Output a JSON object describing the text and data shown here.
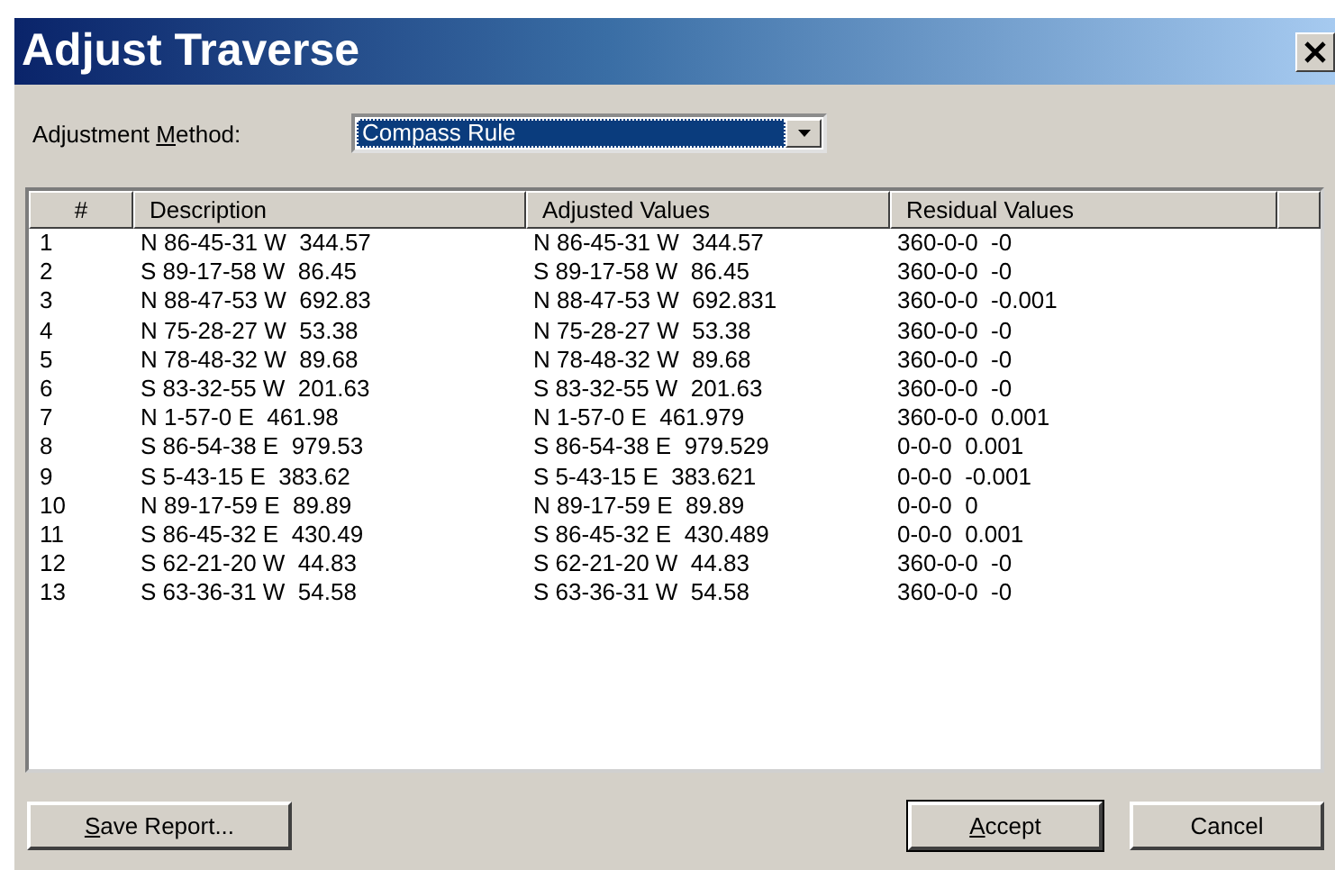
{
  "window": {
    "title": "Adjust Traverse"
  },
  "method": {
    "label": {
      "before": "Adjustment ",
      "key": "M",
      "after": "ethod:"
    },
    "value": "Compass Rule",
    "focused": true
  },
  "table": {
    "columns": [
      "#",
      "Description",
      "Adjusted Values",
      "Residual Values"
    ],
    "rows": [
      [
        "1",
        "N 86-45-31 W  344.57",
        "N 86-45-31 W  344.57",
        "360-0-0  -0"
      ],
      [
        "2",
        "S 89-17-58 W  86.45",
        "S 89-17-58 W  86.45",
        "360-0-0  -0"
      ],
      [
        "3",
        "N 88-47-53 W  692.83",
        "N 88-47-53 W  692.831",
        "360-0-0  -0.001"
      ],
      [
        "4",
        "N 75-28-27 W  53.38",
        "N 75-28-27 W  53.38",
        "360-0-0  -0"
      ],
      [
        "5",
        "N 78-48-32 W  89.68",
        "N 78-48-32 W  89.68",
        "360-0-0  -0"
      ],
      [
        "6",
        "S 83-32-55 W  201.63",
        "S 83-32-55 W  201.63",
        "360-0-0  -0"
      ],
      [
        "7",
        "N 1-57-0 E  461.98",
        "N 1-57-0 E  461.979",
        "360-0-0  0.001"
      ],
      [
        "8",
        "S 86-54-38 E  979.53",
        "S 86-54-38 E  979.529",
        "0-0-0  0.001"
      ],
      [
        "9",
        "S 5-43-15 E  383.62",
        "S 5-43-15 E  383.621",
        "0-0-0  -0.001"
      ],
      [
        "10",
        "N 89-17-59 E  89.89",
        "N 89-17-59 E  89.89",
        "0-0-0  0"
      ],
      [
        "11",
        "S 86-45-32 E  430.49",
        "S 86-45-32 E  430.489",
        "0-0-0  0.001"
      ],
      [
        "12",
        "S 62-21-20 W  44.83",
        "S 62-21-20 W  44.83",
        "360-0-0  -0"
      ],
      [
        "13",
        "S 63-36-31 W  54.58",
        "S 63-36-31 W  54.58",
        "360-0-0  -0"
      ]
    ]
  },
  "buttons": [
    {
      "label": {
        "key": "S",
        "after": "ave Report..."
      },
      "default": false
    },
    {
      "label": {
        "key": "A",
        "after": "ccept"
      },
      "default": true
    },
    {
      "label": {
        "before": "Cancel"
      },
      "default": false
    }
  ]
}
